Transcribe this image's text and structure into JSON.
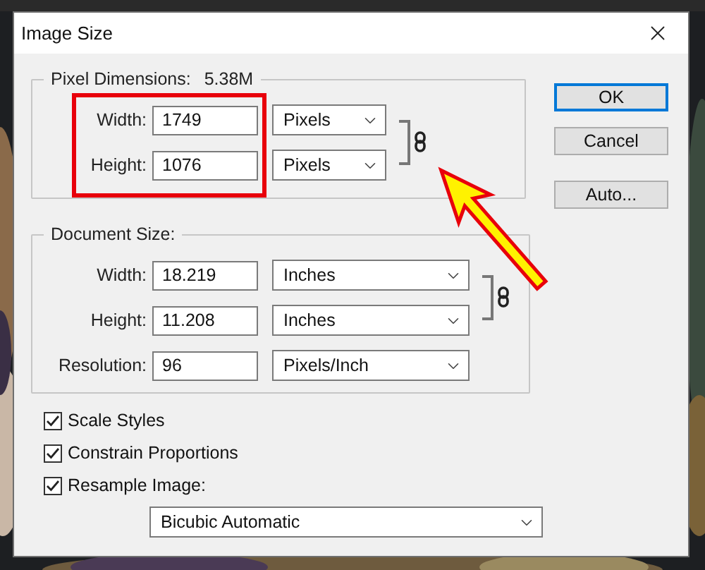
{
  "window": {
    "title": "Image Size"
  },
  "pixel_dimensions": {
    "label": "Pixel Dimensions:",
    "value": "5.38M",
    "linked": true,
    "highlighted": true,
    "fields": [
      {
        "label": "Width:",
        "value": "1749",
        "unit": "Pixels"
      },
      {
        "label": "Height:",
        "value": "1076",
        "unit": "Pixels"
      }
    ]
  },
  "document_size": {
    "label": "Document Size:",
    "linked": true,
    "fields": [
      {
        "label": "Width:",
        "value": "18.219",
        "unit": "Inches"
      },
      {
        "label": "Height:",
        "value": "11.208",
        "unit": "Inches"
      },
      {
        "label": "Resolution:",
        "value": "96",
        "unit": "Pixels/Inch"
      }
    ]
  },
  "options": [
    {
      "label": "Scale Styles",
      "checked": true
    },
    {
      "label": "Constrain Proportions",
      "checked": true
    },
    {
      "label": "Resample Image:",
      "checked": true
    }
  ],
  "resample_method": "Bicubic Automatic",
  "buttons": [
    {
      "label": "OK",
      "default": true
    },
    {
      "label": "Cancel",
      "default": false
    },
    {
      "label": "Auto...",
      "default": false
    }
  ],
  "annotations": [
    {
      "kind": "arrow"
    }
  ]
}
